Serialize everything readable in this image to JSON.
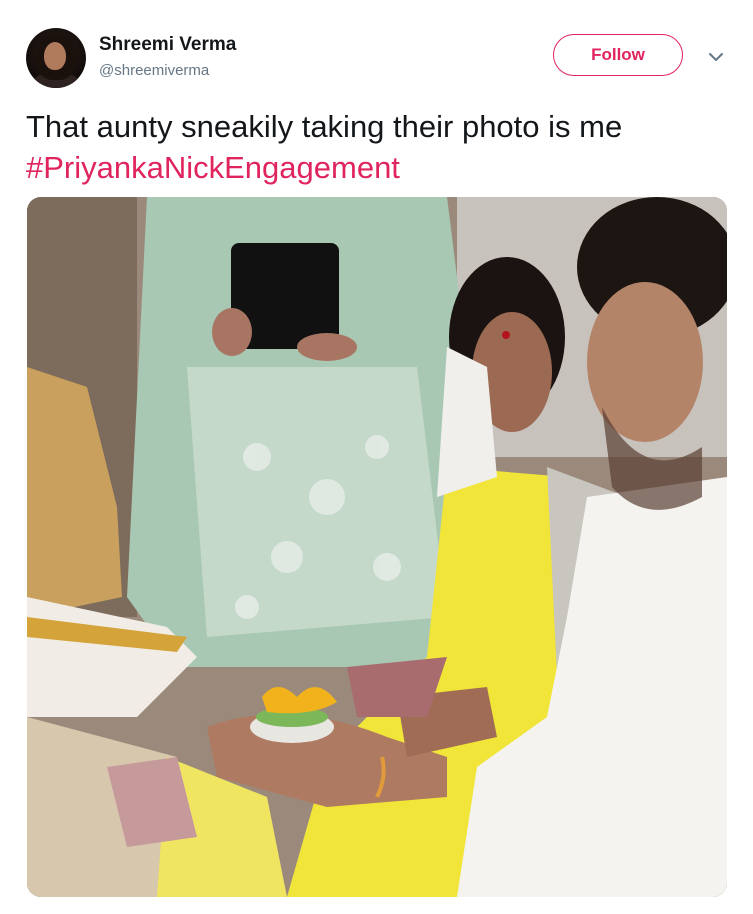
{
  "user": {
    "display_name": "Shreemi Verma",
    "handle": "@shreemiverma"
  },
  "actions": {
    "follow_label": "Follow"
  },
  "tweet": {
    "text": "That aunty sneakily taking their photo is me",
    "hashtag": "#PriyankaNickEngagement"
  },
  "colors": {
    "accent": "#e0245e",
    "text": "#14171a",
    "secondary_text": "#657786"
  },
  "icons": {
    "more": "chevron-down-icon"
  }
}
